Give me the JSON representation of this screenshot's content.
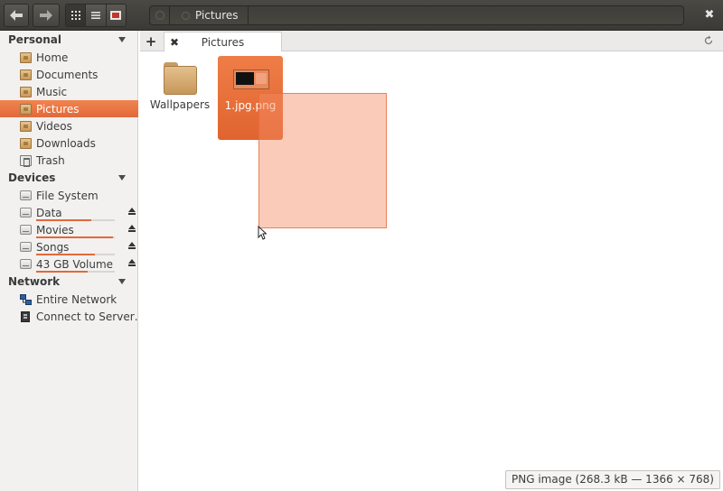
{
  "toolbar": {
    "back_icon": "arrow-left-icon",
    "forward_icon": "arrow-right-icon",
    "view_modes": [
      "icon-view-icon",
      "list-view-icon",
      "column-view-icon"
    ],
    "active_view": "icon-view",
    "path": [
      "Pictures"
    ],
    "close_icon": "close-icon",
    "close_label": "✖"
  },
  "sidebar": {
    "sections": [
      {
        "title": "Personal",
        "items": [
          {
            "label": "Home",
            "icon": "home-folder-icon"
          },
          {
            "label": "Documents",
            "icon": "documents-folder-icon"
          },
          {
            "label": "Music",
            "icon": "music-folder-icon"
          },
          {
            "label": "Pictures",
            "icon": "pictures-folder-icon",
            "selected": true
          },
          {
            "label": "Videos",
            "icon": "videos-folder-icon"
          },
          {
            "label": "Downloads",
            "icon": "downloads-folder-icon"
          },
          {
            "label": "Trash",
            "icon": "trash-icon"
          }
        ]
      },
      {
        "title": "Devices",
        "items": [
          {
            "label": "File System",
            "icon": "drive-icon"
          },
          {
            "label": "Data",
            "icon": "drive-icon",
            "usage": 0.7,
            "eject": true
          },
          {
            "label": "Movies",
            "icon": "drive-icon",
            "usage": 0.98,
            "eject": true
          },
          {
            "label": "Songs",
            "icon": "drive-icon",
            "usage": 0.75,
            "eject": true
          },
          {
            "label": "43 GB Volume",
            "icon": "drive-icon",
            "usage": 0.65,
            "eject": true
          }
        ]
      },
      {
        "title": "Network",
        "items": [
          {
            "label": "Entire Network",
            "icon": "network-icon"
          },
          {
            "label": "Connect to Server…",
            "icon": "server-icon"
          }
        ]
      }
    ]
  },
  "tabs": {
    "add_label": "+",
    "close_label": "✖",
    "items": [
      {
        "label": "Pictures"
      }
    ]
  },
  "content": {
    "files": [
      {
        "name": "Wallpapers",
        "type": "folder"
      },
      {
        "name": "1.jpg.png",
        "type": "image",
        "selected": true
      }
    ]
  },
  "status": {
    "text": "PNG image (268.3 kB — 1366 × 768)"
  },
  "colors": {
    "accent": "#e2693a",
    "toolbar_bg": "#45443f",
    "sidebar_bg": "#f2f1f0",
    "selection_fill": "#f48c64"
  }
}
